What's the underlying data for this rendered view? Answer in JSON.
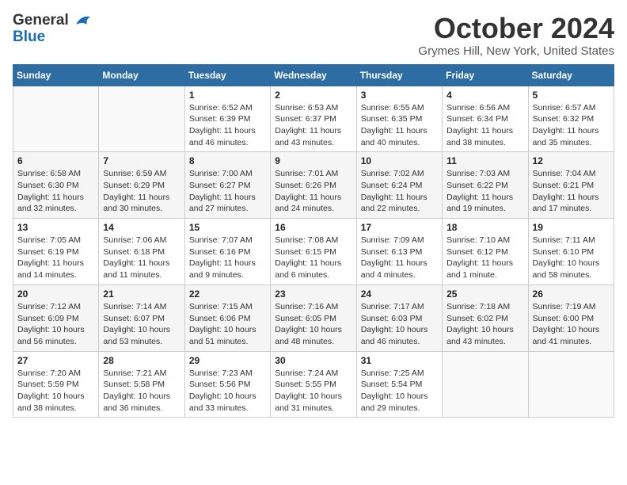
{
  "header": {
    "logo_line1": "General",
    "logo_line2": "Blue",
    "month_title": "October 2024",
    "location": "Grymes Hill, New York, United States"
  },
  "weekdays": [
    "Sunday",
    "Monday",
    "Tuesday",
    "Wednesday",
    "Thursday",
    "Friday",
    "Saturday"
  ],
  "weeks": [
    [
      {
        "day": "",
        "sunrise": "",
        "sunset": "",
        "daylight": ""
      },
      {
        "day": "",
        "sunrise": "",
        "sunset": "",
        "daylight": ""
      },
      {
        "day": "1",
        "sunrise": "Sunrise: 6:52 AM",
        "sunset": "Sunset: 6:39 PM",
        "daylight": "Daylight: 11 hours and 46 minutes."
      },
      {
        "day": "2",
        "sunrise": "Sunrise: 6:53 AM",
        "sunset": "Sunset: 6:37 PM",
        "daylight": "Daylight: 11 hours and 43 minutes."
      },
      {
        "day": "3",
        "sunrise": "Sunrise: 6:55 AM",
        "sunset": "Sunset: 6:35 PM",
        "daylight": "Daylight: 11 hours and 40 minutes."
      },
      {
        "day": "4",
        "sunrise": "Sunrise: 6:56 AM",
        "sunset": "Sunset: 6:34 PM",
        "daylight": "Daylight: 11 hours and 38 minutes."
      },
      {
        "day": "5",
        "sunrise": "Sunrise: 6:57 AM",
        "sunset": "Sunset: 6:32 PM",
        "daylight": "Daylight: 11 hours and 35 minutes."
      }
    ],
    [
      {
        "day": "6",
        "sunrise": "Sunrise: 6:58 AM",
        "sunset": "Sunset: 6:30 PM",
        "daylight": "Daylight: 11 hours and 32 minutes."
      },
      {
        "day": "7",
        "sunrise": "Sunrise: 6:59 AM",
        "sunset": "Sunset: 6:29 PM",
        "daylight": "Daylight: 11 hours and 30 minutes."
      },
      {
        "day": "8",
        "sunrise": "Sunrise: 7:00 AM",
        "sunset": "Sunset: 6:27 PM",
        "daylight": "Daylight: 11 hours and 27 minutes."
      },
      {
        "day": "9",
        "sunrise": "Sunrise: 7:01 AM",
        "sunset": "Sunset: 6:26 PM",
        "daylight": "Daylight: 11 hours and 24 minutes."
      },
      {
        "day": "10",
        "sunrise": "Sunrise: 7:02 AM",
        "sunset": "Sunset: 6:24 PM",
        "daylight": "Daylight: 11 hours and 22 minutes."
      },
      {
        "day": "11",
        "sunrise": "Sunrise: 7:03 AM",
        "sunset": "Sunset: 6:22 PM",
        "daylight": "Daylight: 11 hours and 19 minutes."
      },
      {
        "day": "12",
        "sunrise": "Sunrise: 7:04 AM",
        "sunset": "Sunset: 6:21 PM",
        "daylight": "Daylight: 11 hours and 17 minutes."
      }
    ],
    [
      {
        "day": "13",
        "sunrise": "Sunrise: 7:05 AM",
        "sunset": "Sunset: 6:19 PM",
        "daylight": "Daylight: 11 hours and 14 minutes."
      },
      {
        "day": "14",
        "sunrise": "Sunrise: 7:06 AM",
        "sunset": "Sunset: 6:18 PM",
        "daylight": "Daylight: 11 hours and 11 minutes."
      },
      {
        "day": "15",
        "sunrise": "Sunrise: 7:07 AM",
        "sunset": "Sunset: 6:16 PM",
        "daylight": "Daylight: 11 hours and 9 minutes."
      },
      {
        "day": "16",
        "sunrise": "Sunrise: 7:08 AM",
        "sunset": "Sunset: 6:15 PM",
        "daylight": "Daylight: 11 hours and 6 minutes."
      },
      {
        "day": "17",
        "sunrise": "Sunrise: 7:09 AM",
        "sunset": "Sunset: 6:13 PM",
        "daylight": "Daylight: 11 hours and 4 minutes."
      },
      {
        "day": "18",
        "sunrise": "Sunrise: 7:10 AM",
        "sunset": "Sunset: 6:12 PM",
        "daylight": "Daylight: 11 hours and 1 minute."
      },
      {
        "day": "19",
        "sunrise": "Sunrise: 7:11 AM",
        "sunset": "Sunset: 6:10 PM",
        "daylight": "Daylight: 10 hours and 58 minutes."
      }
    ],
    [
      {
        "day": "20",
        "sunrise": "Sunrise: 7:12 AM",
        "sunset": "Sunset: 6:09 PM",
        "daylight": "Daylight: 10 hours and 56 minutes."
      },
      {
        "day": "21",
        "sunrise": "Sunrise: 7:14 AM",
        "sunset": "Sunset: 6:07 PM",
        "daylight": "Daylight: 10 hours and 53 minutes."
      },
      {
        "day": "22",
        "sunrise": "Sunrise: 7:15 AM",
        "sunset": "Sunset: 6:06 PM",
        "daylight": "Daylight: 10 hours and 51 minutes."
      },
      {
        "day": "23",
        "sunrise": "Sunrise: 7:16 AM",
        "sunset": "Sunset: 6:05 PM",
        "daylight": "Daylight: 10 hours and 48 minutes."
      },
      {
        "day": "24",
        "sunrise": "Sunrise: 7:17 AM",
        "sunset": "Sunset: 6:03 PM",
        "daylight": "Daylight: 10 hours and 46 minutes."
      },
      {
        "day": "25",
        "sunrise": "Sunrise: 7:18 AM",
        "sunset": "Sunset: 6:02 PM",
        "daylight": "Daylight: 10 hours and 43 minutes."
      },
      {
        "day": "26",
        "sunrise": "Sunrise: 7:19 AM",
        "sunset": "Sunset: 6:00 PM",
        "daylight": "Daylight: 10 hours and 41 minutes."
      }
    ],
    [
      {
        "day": "27",
        "sunrise": "Sunrise: 7:20 AM",
        "sunset": "Sunset: 5:59 PM",
        "daylight": "Daylight: 10 hours and 38 minutes."
      },
      {
        "day": "28",
        "sunrise": "Sunrise: 7:21 AM",
        "sunset": "Sunset: 5:58 PM",
        "daylight": "Daylight: 10 hours and 36 minutes."
      },
      {
        "day": "29",
        "sunrise": "Sunrise: 7:23 AM",
        "sunset": "Sunset: 5:56 PM",
        "daylight": "Daylight: 10 hours and 33 minutes."
      },
      {
        "day": "30",
        "sunrise": "Sunrise: 7:24 AM",
        "sunset": "Sunset: 5:55 PM",
        "daylight": "Daylight: 10 hours and 31 minutes."
      },
      {
        "day": "31",
        "sunrise": "Sunrise: 7:25 AM",
        "sunset": "Sunset: 5:54 PM",
        "daylight": "Daylight: 10 hours and 29 minutes."
      },
      {
        "day": "",
        "sunrise": "",
        "sunset": "",
        "daylight": ""
      },
      {
        "day": "",
        "sunrise": "",
        "sunset": "",
        "daylight": ""
      }
    ]
  ]
}
